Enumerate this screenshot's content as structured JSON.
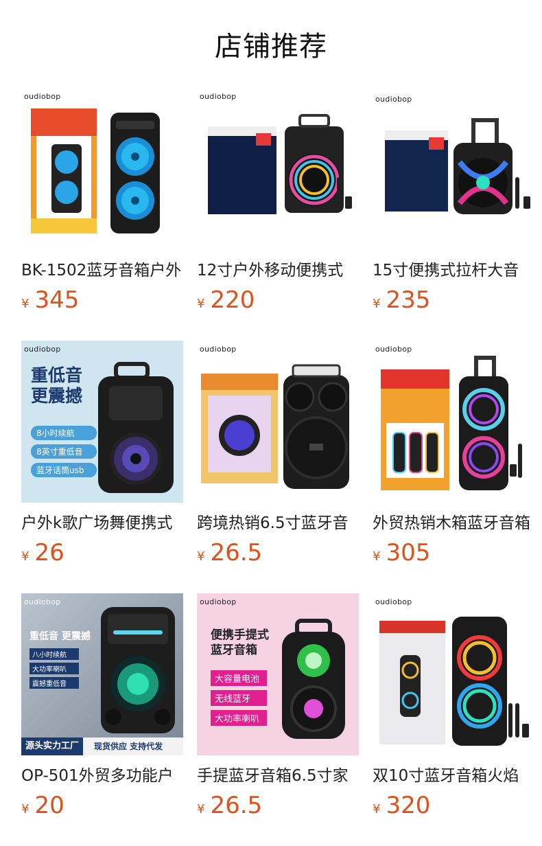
{
  "header": {
    "title": "店铺推荐"
  },
  "brand": {
    "logo_text": "oudiobop"
  },
  "currency_symbol": "¥",
  "products": [
    {
      "title": "BK-1502蓝牙音箱户外",
      "price": "345"
    },
    {
      "title": "12寸户外移动便携式",
      "price": "220"
    },
    {
      "title": "15寸便携式拉杆大音",
      "price": "235"
    },
    {
      "title": "户外k歌广场舞便携式",
      "price": "26"
    },
    {
      "title": "跨境热销6.5寸蓝牙音",
      "price": "26.5"
    },
    {
      "title": "外贸热销木箱蓝牙音箱",
      "price": "305"
    },
    {
      "title": "OP-501外贸多功能户",
      "price": "20"
    },
    {
      "title": "手提蓝牙音箱6.5寸家",
      "price": "26.5"
    },
    {
      "title": "双10寸蓝牙音箱火焰",
      "price": "320"
    }
  ],
  "promo": {
    "p4": {
      "headline_1": "重低音",
      "headline_2": "更震撼",
      "tag_1": "8小时续航",
      "tag_2": "8英寸重低音",
      "tag_3": "蓝牙话筒usb"
    },
    "p7": {
      "headline": "重低音 更震撼",
      "tag_1": "八小时续航",
      "tag_2": "大功率喇叭",
      "tag_3": "震撼重低音",
      "banner_1": "源头实力工厂",
      "banner_2": "现货供应 支持代发",
      "model": "OP-501"
    },
    "p8": {
      "headline_1": "便携手提式",
      "headline_2": "蓝牙音箱",
      "tag_1": "大容量电池",
      "tag_2": "无线蓝牙",
      "tag_3": "大功率喇叭"
    }
  },
  "colors": {
    "price": "#e0501c",
    "promo_blue": "#1d3a6e",
    "promo_pink": "#e0208f"
  }
}
